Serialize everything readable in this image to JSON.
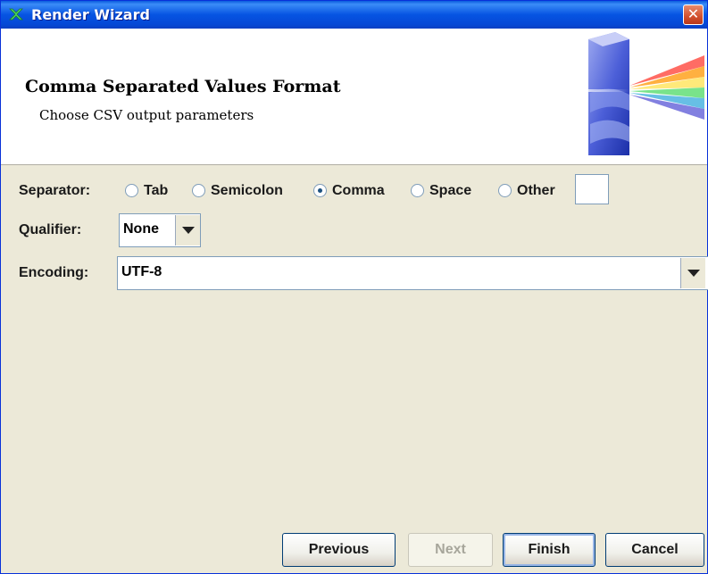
{
  "window": {
    "title": "Render Wizard",
    "close_glyph": "✕"
  },
  "header": {
    "title": "Comma Separated Values Format",
    "subtitle": "Choose CSV output parameters"
  },
  "separator": {
    "label": "Separator:",
    "options": [
      {
        "label": "Tab",
        "selected": false
      },
      {
        "label": "Semicolon",
        "selected": false
      },
      {
        "label": "Comma",
        "selected": true
      },
      {
        "label": "Space",
        "selected": false
      },
      {
        "label": "Other",
        "selected": false
      }
    ],
    "other_value": ""
  },
  "qualifier": {
    "label": "Qualifier:",
    "value": "None"
  },
  "encoding": {
    "label": "Encoding:",
    "value": "UTF-8"
  },
  "buttons": {
    "previous": "Previous",
    "next": "Next",
    "finish": "Finish",
    "cancel": "Cancel"
  },
  "icons": {
    "app": "render-wizard-icon",
    "header": "prism-graphic"
  },
  "colors": {
    "titlebar": "#0654E2",
    "background": "#ECE9D8",
    "close": "#D2502E"
  }
}
